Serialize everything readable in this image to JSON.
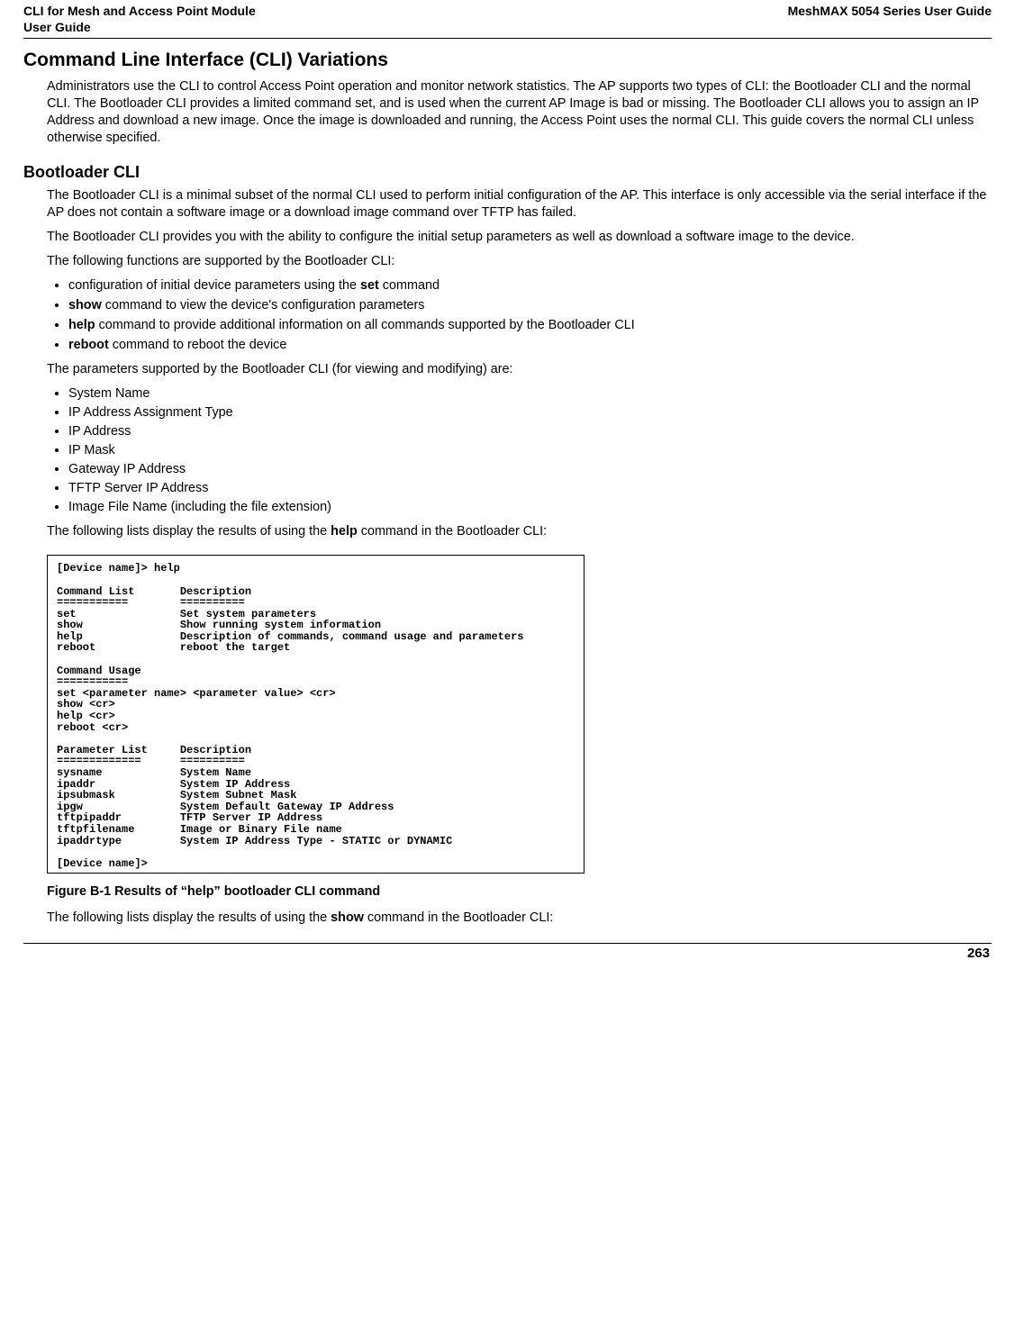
{
  "header": {
    "left1": "CLI for Mesh and Access Point Module",
    "left2": " User Guide",
    "right": "MeshMAX 5054 Series User Guide"
  },
  "h1": "Command Line Interface (CLI) Variations",
  "p1": "Administrators use the CLI to control Access Point operation and monitor network statistics. The AP supports two types of CLI: the Bootloader CLI and the normal CLI. The Bootloader CLI provides a limited command set, and is used when the current AP Image is bad or missing. The Bootloader CLI allows you to assign an IP Address and download a new image. Once the image is downloaded and running, the Access Point uses the normal CLI. This guide covers the normal CLI unless otherwise specified.",
  "h2": "Bootloader CLI",
  "p2": "The Bootloader CLI is a minimal subset of the normal CLI used to perform initial configuration of the AP. This interface is only accessible via the serial interface if the AP does not contain a software image or a download image command over TFTP has failed.",
  "p3": "The Bootloader CLI provides you with the ability to configure the initial setup parameters as well as download a software image to the device.",
  "p4": "The following functions are supported by the Bootloader CLI:",
  "funcs": {
    "i0a": "configuration of initial device parameters using the ",
    "i0b": "set",
    "i0c": " command",
    "i1a": "show",
    "i1b": " command to view the device's configuration parameters",
    "i2a": "help",
    "i2b": " command to provide additional information on all commands supported by the Bootloader CLI",
    "i3a": "reboot",
    "i3b": " command to reboot the device"
  },
  "p5": "The parameters supported by the Bootloader CLI (for viewing and modifying) are:",
  "params": {
    "i0": "System Name",
    "i1": "IP Address Assignment Type",
    "i2": "IP Address",
    "i3": "IP Mask",
    "i4": "Gateway IP Address",
    "i5": "TFTP Server IP Address",
    "i6": "Image File Name (including the file extension)"
  },
  "p6a": "The following lists display the results of using the ",
  "p6b": "help",
  "p6c": " command in the Bootloader CLI:",
  "console": "[Device name]> help\n\nCommand List       Description\n===========        ==========\nset                Set system parameters\nshow               Show running system information\nhelp               Description of commands, command usage and parameters\nreboot             reboot the target\n\nCommand Usage\n===========\nset <parameter name> <parameter value> <cr>\nshow <cr>\nhelp <cr>\nreboot <cr>\n\nParameter List     Description\n=============      ==========\nsysname            System Name\nipaddr             System IP Address\nipsubmask          System Subnet Mask\nipgw               System Default Gateway IP Address\ntftpipaddr         TFTP Server IP Address\ntftpfilename       Image or Binary File name\nipaddrtype         System IP Address Type - STATIC or DYNAMIC\n\n[Device name]>",
  "figcap": "Figure B-1 Results of “help” bootloader CLI command",
  "p7a": "The following lists display the results of using the ",
  "p7b": "show",
  "p7c": " command in the Bootloader CLI:",
  "pagenum": "263"
}
